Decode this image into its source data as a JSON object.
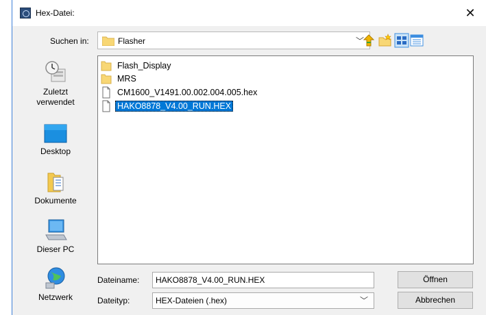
{
  "window": {
    "title": "Hex-Datei:",
    "close_glyph": "✕"
  },
  "toolbar": {
    "look_in_label": "Suchen in:",
    "look_in_value": "Flasher",
    "chevron": "﹀",
    "icons": [
      "up-folder-icon",
      "new-folder-icon",
      "view-menu-icon",
      "details-view-icon"
    ]
  },
  "places": [
    {
      "label": "Zuletzt verwendet",
      "icon": "recent-icon"
    },
    {
      "label": "Desktop",
      "icon": "desktop-icon"
    },
    {
      "label": "Dokumente",
      "icon": "documents-icon"
    },
    {
      "label": "Dieser PC",
      "icon": "computer-icon"
    },
    {
      "label": "Netzwerk",
      "icon": "network-icon"
    }
  ],
  "files": [
    {
      "name": "Flash_Display",
      "type": "folder",
      "selected": false
    },
    {
      "name": "MRS",
      "type": "folder",
      "selected": false
    },
    {
      "name": "CM1600_V1491.00.002.004.005.hex",
      "type": "file",
      "selected": false
    },
    {
      "name": "HAKO8878_V4.00_RUN.HEX",
      "type": "file",
      "selected": true
    }
  ],
  "filename": {
    "label": "Dateiname:",
    "value": "HAKO8878_V4.00_RUN.HEX"
  },
  "filetype": {
    "label": "Dateityp:",
    "value": "HEX-Dateien (.hex)"
  },
  "buttons": {
    "open": "Öffnen",
    "cancel": "Abbrechen"
  },
  "colors": {
    "selection": "#0078d7",
    "folder": "#f8d775",
    "window_border": "#3c7fd8"
  }
}
